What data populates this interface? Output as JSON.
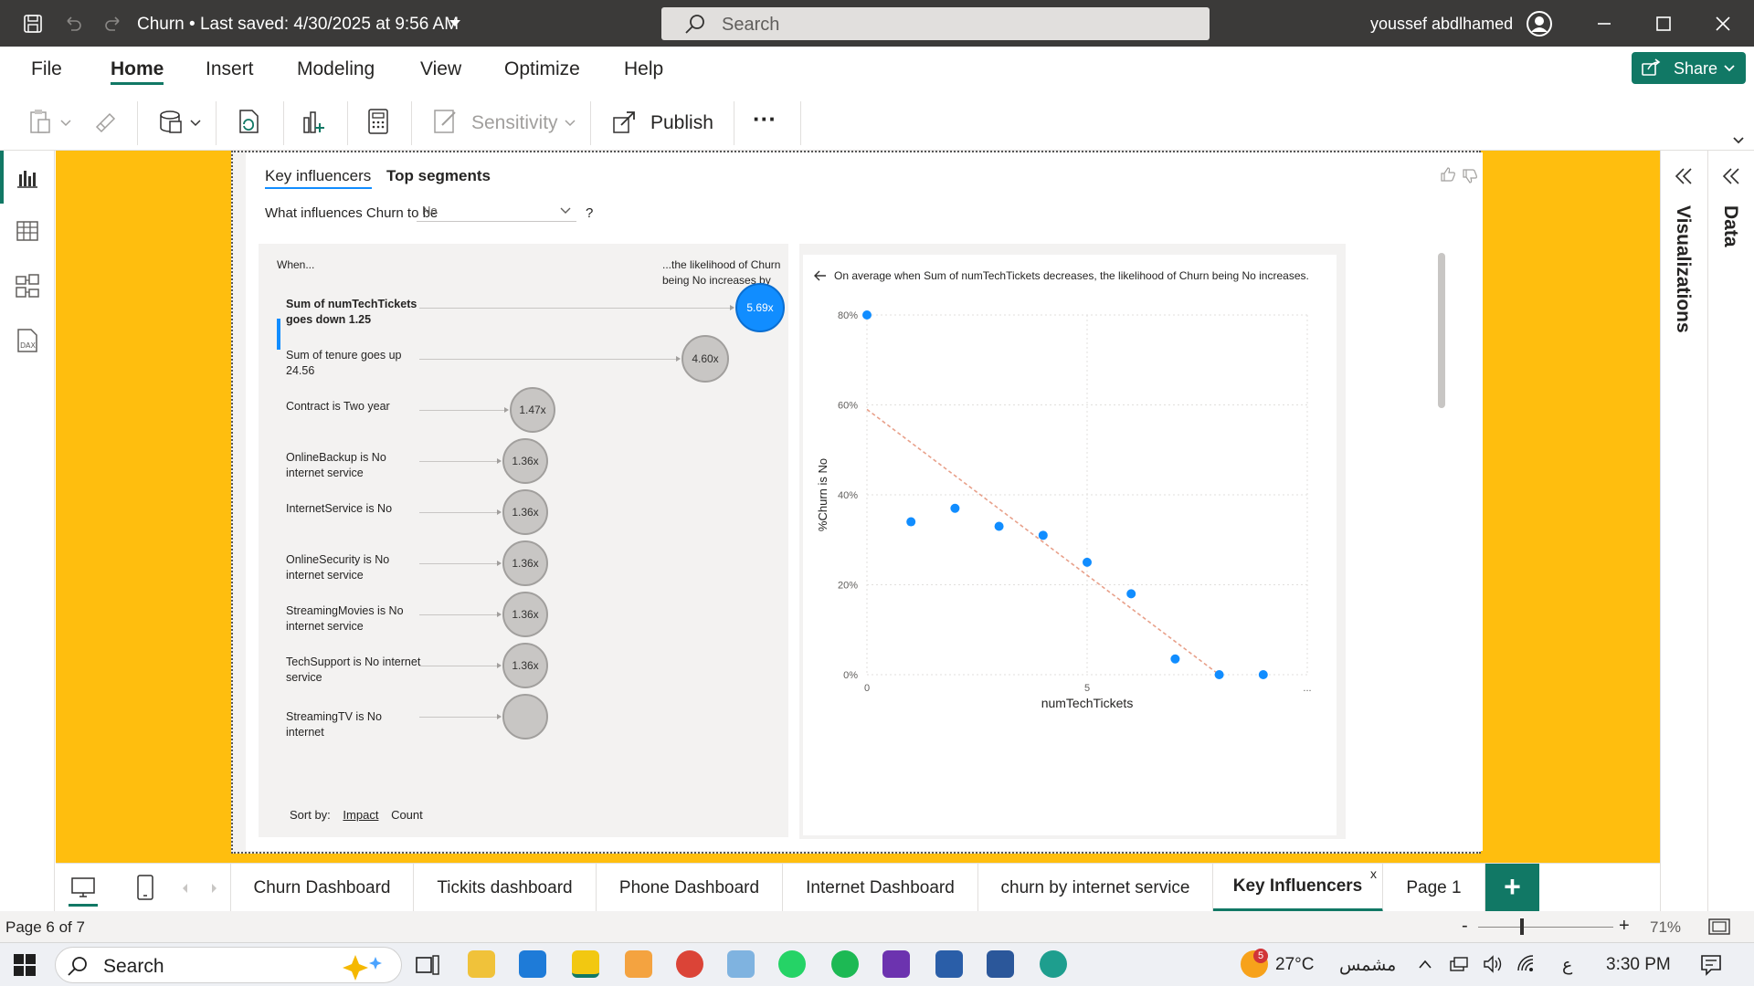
{
  "titlebar": {
    "doc_title": "Churn • Last saved: 4/30/2025 at 9:56 AM",
    "search_placeholder": "Search",
    "user_name": "youssef abdlhamed"
  },
  "menu": {
    "tabs": [
      "File",
      "Home",
      "Insert",
      "Modeling",
      "View",
      "Optimize",
      "Help"
    ],
    "active": "Home",
    "share_label": "Share"
  },
  "ribbon": {
    "sensitivity_label": "Sensitivity",
    "publish_label": "Publish",
    "more_label": "···"
  },
  "visual": {
    "tab_key_influencers": "Key influencers",
    "tab_top_segments": "Top segments",
    "question_prefix": "What influences Churn to be",
    "question_value": "No",
    "question_suffix": "?",
    "when_label": "When...",
    "likelihood_label": "...the likelihood of Churn being No increases by",
    "influencers": [
      {
        "label": "Sum of numTechTickets goes down 1.25",
        "value": "5.69x",
        "selected": true
      },
      {
        "label": "Sum of tenure goes up 24.56",
        "value": "4.60x",
        "selected": false
      },
      {
        "label": "Contract is Two year",
        "value": "1.47x",
        "selected": false
      },
      {
        "label": "OnlineBackup is No internet service",
        "value": "1.36x",
        "selected": false
      },
      {
        "label": "InternetService is No",
        "value": "1.36x",
        "selected": false
      },
      {
        "label": "OnlineSecurity is No internet service",
        "value": "1.36x",
        "selected": false
      },
      {
        "label": "StreamingMovies is No internet service",
        "value": "1.36x",
        "selected": false
      },
      {
        "label": "TechSupport is No internet service",
        "value": "1.36x",
        "selected": false
      },
      {
        "label": "StreamingTV is No internet",
        "value": "",
        "selected": false
      }
    ],
    "sort_by_label": "Sort by:",
    "sort_impact": "Impact",
    "sort_count": "Count",
    "detail_text": "On average when Sum of numTechTickets decreases, the likelihood of Churn being No increases."
  },
  "chart_data": {
    "type": "scatter",
    "xlabel": "numTechTickets",
    "ylabel": "%Churn is No",
    "x_ticks": [
      "0",
      "5",
      "..."
    ],
    "y_ticks": [
      "0%",
      "20%",
      "40%",
      "60%",
      "80%"
    ],
    "xlim": [
      0,
      10
    ],
    "ylim": [
      0,
      80
    ],
    "points": [
      {
        "x": 0,
        "y": 80
      },
      {
        "x": 1,
        "y": 34
      },
      {
        "x": 2,
        "y": 37
      },
      {
        "x": 3,
        "y": 33
      },
      {
        "x": 4,
        "y": 31
      },
      {
        "x": 5,
        "y": 25
      },
      {
        "x": 6,
        "y": 18
      },
      {
        "x": 7,
        "y": 3.5
      },
      {
        "x": 8,
        "y": 0
      },
      {
        "x": 9,
        "y": 0
      }
    ],
    "trend": {
      "x0": 0,
      "y0": 59,
      "x1": 8,
      "y1": 0
    },
    "point_color": "#118dff",
    "trend_color": "#e8a08a"
  },
  "panes": {
    "visualizations_label": "Visualizations",
    "data_label": "Data"
  },
  "pages": {
    "tabs": [
      "Churn Dashboard",
      "Tickits dashboard",
      "Phone Dashboard",
      "Internet Dashboard",
      "churn by internet service",
      "Key Influencers",
      "Page 1"
    ],
    "active": "Key Influencers",
    "close_label": "x",
    "add_label": "+"
  },
  "status": {
    "page_info": "Page 6 of 7",
    "zoom": "71%",
    "zoom_minus": "-",
    "zoom_plus": "+"
  },
  "taskbar": {
    "search_placeholder": "Search",
    "weather_temp": "27°C",
    "weather_text": "مشمس",
    "weather_badge": "5",
    "lang": "ع",
    "time": "3:30 PM"
  },
  "colors": {
    "accent": "#117865",
    "page_bg": "#ffbe0e",
    "selected_bubble": "#118dff"
  }
}
